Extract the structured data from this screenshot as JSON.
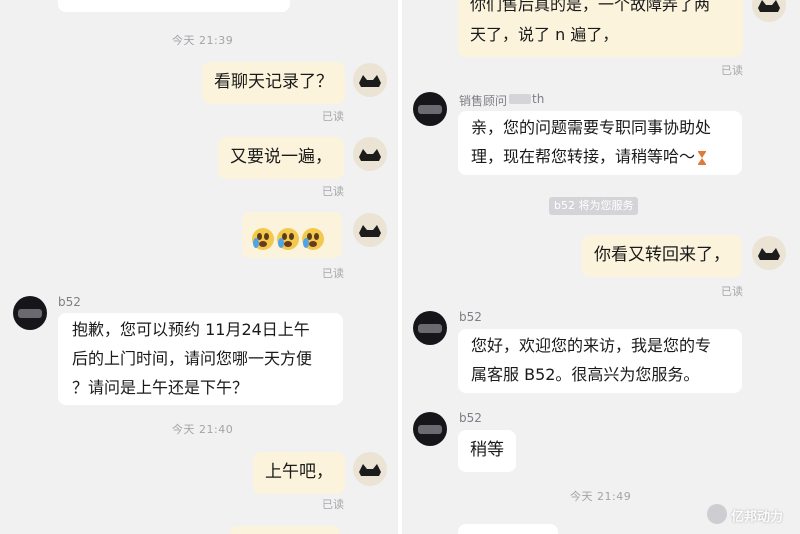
{
  "left": {
    "timestamps": [
      "今天 21:39",
      "今天 21:40"
    ],
    "messages_out": [
      {
        "text": "看聊天记录了？",
        "status": "已读"
      },
      {
        "text": "又要说一遍，",
        "status": "已读"
      },
      {
        "emoji": [
          "loudly-crying-face",
          "loudly-crying-face",
          "loudly-crying-face"
        ],
        "status": "已读"
      },
      {
        "text": "上午吧，",
        "status": "已读"
      }
    ],
    "agent_reply": {
      "sender": "b52",
      "lines": [
        "抱歉，您可以预约 11月24日上午",
        "后的上门时间，请问您哪一天方便",
        "？请问是上午还是下午？"
      ]
    }
  },
  "right": {
    "top_message": {
      "lines": [
        "你们售后真的是，一个故障弄了两",
        "天了，说了 n 遍了，"
      ],
      "status": "已读"
    },
    "advisor_message": {
      "sender_prefix": "销售顾问",
      "sender_suffix": "th",
      "lines": [
        "亲，您的问题需要专职同事协助处",
        "理，现在帮您转接，请稍等哈～"
      ],
      "trailing_icon": "hourglass-icon"
    },
    "system_note": "b52 将为您服务",
    "user_message": {
      "text": "你看又转回来了，",
      "status": "已读"
    },
    "welcome_message": {
      "sender": "b52",
      "lines": [
        "您好，欢迎您的来访，我是您的专",
        "属客服 B52。很高兴为您服务。"
      ]
    },
    "wait_message": {
      "sender": "b52",
      "text": "稍等"
    },
    "timestamp": "今天 21:49"
  },
  "watermark": {
    "text": "亿邦动力",
    "icon": "logo-icon"
  },
  "colors": {
    "outgoing_bubble": "#fbf3dc",
    "incoming_bubble": "#ffffff",
    "background": "#f1f1f2"
  }
}
